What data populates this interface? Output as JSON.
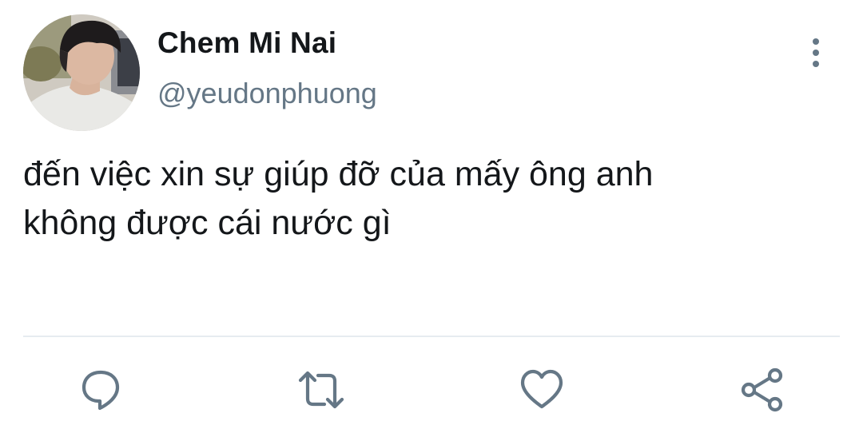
{
  "author": {
    "display_name": "Chem Mi Nai",
    "handle": "@yeudonphuong"
  },
  "tweet": {
    "lines": [
      "đến việc xin sự giúp đỡ của mấy ông anh",
      "không được cái nước gì"
    ]
  },
  "actions": {
    "reply": "reply-icon",
    "retweet": "retweet-icon",
    "like": "heart-icon",
    "share": "share-icon",
    "more": "more-vertical-icon"
  },
  "colors": {
    "text": "#14171a",
    "secondary": "#657786",
    "divider": "#e6ecf0"
  }
}
